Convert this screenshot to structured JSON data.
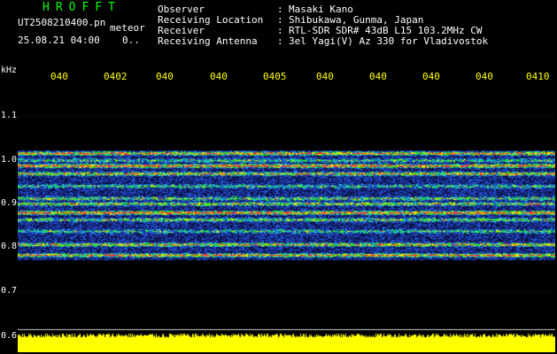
{
  "header": {
    "logo": "HROFFT",
    "filename": "UT2508210400.pn",
    "meteor_label": "meteor",
    "datetime": "25.08.21 04:00",
    "counter": "0..",
    "rows": [
      {
        "key": "Observer",
        "value": "Masaki Kano"
      },
      {
        "key": "Receiving Location",
        "value": "Shibukawa, Gunma, Japan"
      },
      {
        "key": "Receiver",
        "value": "RTL-SDR SDR# 43dB L15 103.2MHz CW"
      },
      {
        "key": "Receiving Antenna",
        "value": "3el Yagi(V) Az 330 for Vladivostok"
      }
    ],
    "separator": ":"
  },
  "y_axis": {
    "unit": "kHz",
    "ticks": [
      "1.1",
      "1.0",
      "0.9",
      "0.8",
      "0.7",
      "0.6"
    ]
  },
  "x_axis": {
    "ticks": [
      "040",
      "0402",
      "040",
      "040",
      "0405",
      "040",
      "040",
      "040",
      "040",
      "0410"
    ]
  },
  "colors": {
    "logo": "#00ff00",
    "text": "#ffffff",
    "time_labels": "#ffff00",
    "noise_floor": "#ffff00",
    "signal_band_base": "#1a2a8a",
    "hot_line": "#ff3030"
  }
}
